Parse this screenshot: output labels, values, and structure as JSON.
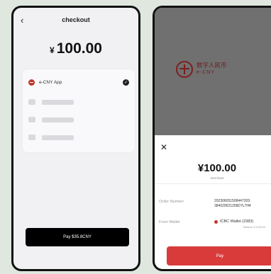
{
  "screen1": {
    "title": "checkout",
    "currency_symbol": "¥",
    "amount": "100.00",
    "methods": [
      {
        "label": "e-CNY App",
        "selected": true
      }
    ],
    "pay_label": "Pay $35.8CNY",
    "icons": [
      "back-icon",
      "ecny-logo-icon",
      "check-icon"
    ]
  },
  "screen2": {
    "brand_cn": "数字人民币",
    "brand_en": "e-CNY",
    "amount": "¥100.00",
    "merchant": "merchant",
    "order_label": "Order Number",
    "order_value_line1": "20230605150844720S",
    "order_value_line2": "384029521258D7L7H4",
    "wallet_label": "From Wallet",
    "wallet_value": "ICBC Wallet (2383)",
    "balance": "Balance: ¥ 2,025.00",
    "pay_label": "Pay",
    "icons": [
      "close-icon",
      "ecny-logo-icon",
      "wallet-bank-icon"
    ]
  },
  "colors": {
    "accent_red": "#d93b3b",
    "background": "#dfe7df",
    "top_gray": "#707070",
    "button_black": "#000000"
  }
}
